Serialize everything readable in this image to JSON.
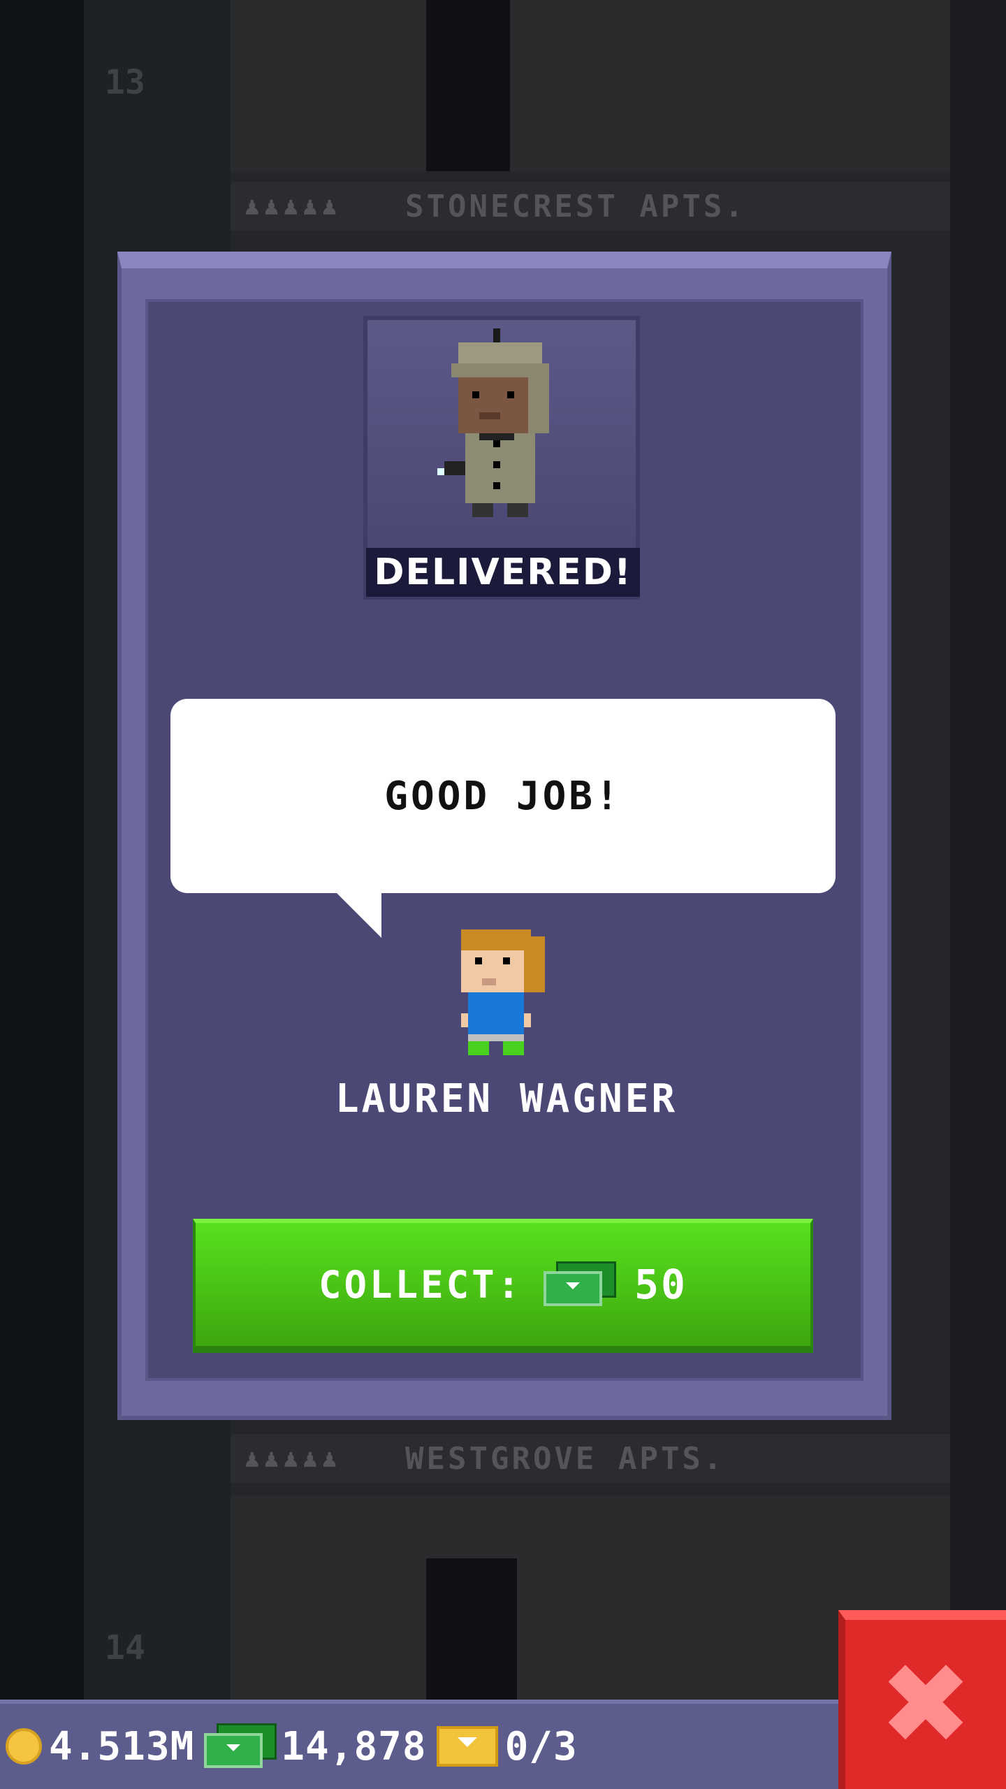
{
  "background": {
    "floors": [
      {
        "number": "13",
        "name": "STONECREST APTS."
      },
      {
        "number": "14",
        "name": "WESTGROVE APTS."
      }
    ]
  },
  "modal": {
    "status_label": "DELIVERED!",
    "speech_text": "GOOD JOB!",
    "tenant_name": "LAUREN WAGNER",
    "collect_label": "COLLECT:",
    "collect_amount": "50"
  },
  "currency_bar": {
    "coins": "4.513M",
    "bux": "14,878",
    "tickets": "0/3"
  },
  "colors": {
    "modal_bg": "#4b4876",
    "collect_green": "#4dc41a",
    "close_red": "#e02a2a"
  },
  "icons": {
    "close": "close-icon",
    "bux": "bux-icon",
    "coin": "coin-icon",
    "ticket": "golden-ticket-icon"
  }
}
